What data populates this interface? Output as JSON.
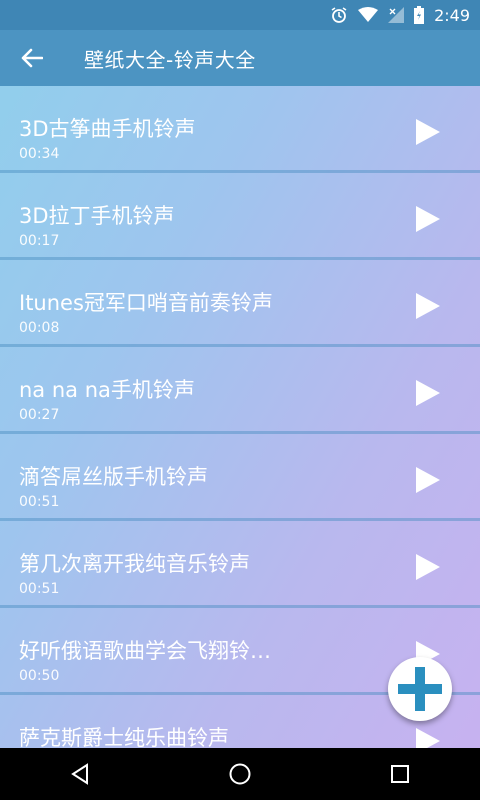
{
  "status": {
    "time": "2:49"
  },
  "toolbar": {
    "title": "壁纸大全-铃声大全"
  },
  "items": [
    {
      "title": "3D古筝曲手机铃声",
      "duration": "00:34"
    },
    {
      "title": "3D拉丁手机铃声",
      "duration": "00:17"
    },
    {
      "title": "Itunes冠军口哨音前奏铃声",
      "duration": "00:08"
    },
    {
      "title": "na na na手机铃声",
      "duration": "00:27"
    },
    {
      "title": "滴答屌丝版手机铃声",
      "duration": "00:51"
    },
    {
      "title": "第几次离开我纯音乐铃声",
      "duration": "00:51"
    },
    {
      "title": "好听俄语歌曲学会飞翔铃…",
      "duration": "00:50"
    },
    {
      "title": "萨克斯爵士纯乐曲铃声",
      "duration": ""
    }
  ],
  "colors": {
    "statusbar": "#3f86b5",
    "appbar": "#4c94c2",
    "fab_plus": "#2a8fbf"
  }
}
